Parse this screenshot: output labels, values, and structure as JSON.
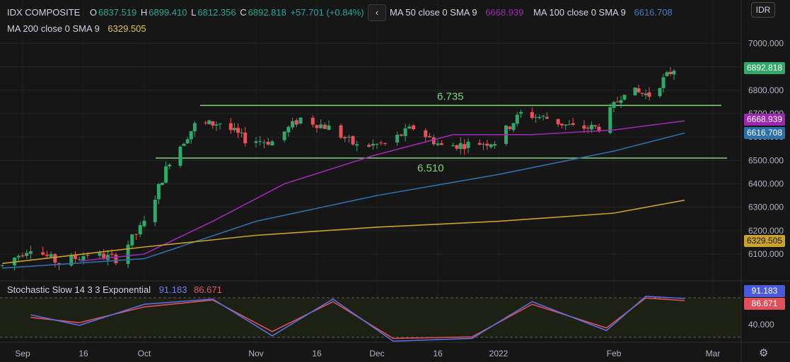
{
  "header": {
    "symbol": "IDX COMPOSITE",
    "open_label": "O",
    "open": "6837.519",
    "high_label": "H",
    "high": "6899.410",
    "low_label": "L",
    "low": "6812.356",
    "close_label": "C",
    "close": "6892.818",
    "change": "+57.701 (+0.84%)",
    "ma50_label": "MA 50 close 0 SMA 9",
    "ma50_value": "6668.939",
    "ma100_label": "MA 100 close 0 SMA 9",
    "ma100_value": "6616.708",
    "ma200_label": "MA 200 close 0 SMA 9",
    "ma200_value": "6329.505",
    "back_icon": "‹"
  },
  "currency_button": "IDR",
  "indicator": {
    "label": "Stochastic Slow 14 3 3 Exponential",
    "k_value": "91.183",
    "d_value": "86.671",
    "axis_ticks": [
      "40.000"
    ]
  },
  "price_tags": {
    "last": "6892.818",
    "ma50": "6668.939",
    "ma100": "6616.708",
    "ma200": "6329.505"
  },
  "colors": {
    "up": "#26a69a",
    "up_candle": "#2fa86a",
    "down_candle": "#e8505b",
    "ma50": "#9c27b0",
    "ma100": "#2d6fa8",
    "ma200": "#c9a227",
    "support": "#7fd47f",
    "k_line": "#5b6fe0",
    "d_line": "#e0505b"
  },
  "chart_data": {
    "type": "line",
    "title": "IDX COMPOSITE",
    "x_ticks": [
      "Sep",
      "16",
      "Oct",
      "Nov",
      "16",
      "Dec",
      "16",
      "2022",
      "Feb",
      "Mar"
    ],
    "y_ticks": [
      "6100.000",
      "6200.000",
      "6300.000",
      "6400.000",
      "6500.000",
      "6600.000",
      "6700.000",
      "6800.000",
      "6900.000",
      "7000.000"
    ],
    "ylim": [
      6010,
      7060
    ],
    "annotations": [
      {
        "label": "6.735",
        "value": 6735
      },
      {
        "label": "6.510",
        "value": 6510
      }
    ],
    "price_path": [
      [
        "2021-08-27",
        6050
      ],
      [
        "2021-09-03",
        6130
      ],
      [
        "2021-09-10",
        6060
      ],
      [
        "2021-09-17",
        6100
      ],
      [
        "2021-09-24",
        6080
      ],
      [
        "2021-10-01",
        6230
      ],
      [
        "2021-10-08",
        6500
      ],
      [
        "2021-10-15",
        6650
      ],
      [
        "2021-10-22",
        6660
      ],
      [
        "2021-10-29",
        6590
      ],
      [
        "2021-11-05",
        6580
      ],
      [
        "2021-11-12",
        6680
      ],
      [
        "2021-11-19",
        6640
      ],
      [
        "2021-11-26",
        6560
      ],
      [
        "2021-12-03",
        6570
      ],
      [
        "2021-12-10",
        6640
      ],
      [
        "2021-12-17",
        6560
      ],
      [
        "2021-12-24",
        6570
      ],
      [
        "2021-12-31",
        6580
      ],
      [
        "2022-01-07",
        6700
      ],
      [
        "2022-01-14",
        6680
      ],
      [
        "2022-01-21",
        6640
      ],
      [
        "2022-01-28",
        6640
      ],
      [
        "2022-02-04",
        6800
      ],
      [
        "2022-02-11",
        6780
      ],
      [
        "2022-02-18",
        6893
      ]
    ],
    "series": [
      {
        "name": "MA 50 close 0 SMA 9",
        "color": "#9c27b0",
        "values": [
          [
            "2021-09-15",
            6070
          ],
          [
            "2021-10-01",
            6100
          ],
          [
            "2021-10-20",
            6240
          ],
          [
            "2021-11-08",
            6400
          ],
          [
            "2021-11-30",
            6520
          ],
          [
            "2021-12-20",
            6610
          ],
          [
            "2022-01-10",
            6610
          ],
          [
            "2022-02-01",
            6630
          ],
          [
            "2022-02-21",
            6669
          ]
        ]
      },
      {
        "name": "MA 100 close 0 SMA 9",
        "color": "#2d6fa8",
        "values": [
          [
            "2021-08-27",
            6040
          ],
          [
            "2021-10-01",
            6080
          ],
          [
            "2021-11-01",
            6240
          ],
          [
            "2021-12-01",
            6350
          ],
          [
            "2022-01-01",
            6440
          ],
          [
            "2022-02-01",
            6540
          ],
          [
            "2022-02-21",
            6617
          ]
        ]
      },
      {
        "name": "MA 200 close 0 SMA 9",
        "color": "#c9a227",
        "values": [
          [
            "2021-08-27",
            6060
          ],
          [
            "2021-10-01",
            6130
          ],
          [
            "2021-11-01",
            6180
          ],
          [
            "2021-12-01",
            6215
          ],
          [
            "2022-01-01",
            6240
          ],
          [
            "2022-02-01",
            6275
          ],
          [
            "2022-02-21",
            6330
          ]
        ]
      }
    ],
    "stochastic": {
      "k_name": "91.183",
      "d_name": "86.671",
      "k": [
        [
          "2021-09-03",
          60
        ],
        [
          "2021-09-15",
          40
        ],
        [
          "2021-10-01",
          80
        ],
        [
          "2021-10-20",
          90
        ],
        [
          "2021-11-05",
          20
        ],
        [
          "2021-11-20",
          90
        ],
        [
          "2021-12-05",
          10
        ],
        [
          "2021-12-25",
          15
        ],
        [
          "2022-01-10",
          85
        ],
        [
          "2022-01-30",
          30
        ],
        [
          "2022-02-10",
          95
        ],
        [
          "2022-02-21",
          91
        ]
      ],
      "d": [
        [
          "2021-09-03",
          55
        ],
        [
          "2021-09-15",
          45
        ],
        [
          "2021-10-01",
          75
        ],
        [
          "2021-10-20",
          88
        ],
        [
          "2021-11-05",
          28
        ],
        [
          "2021-11-20",
          85
        ],
        [
          "2021-12-05",
          15
        ],
        [
          "2021-12-25",
          18
        ],
        [
          "2022-01-10",
          80
        ],
        [
          "2022-01-30",
          35
        ],
        [
          "2022-02-10",
          92
        ],
        [
          "2022-02-21",
          87
        ]
      ]
    }
  }
}
